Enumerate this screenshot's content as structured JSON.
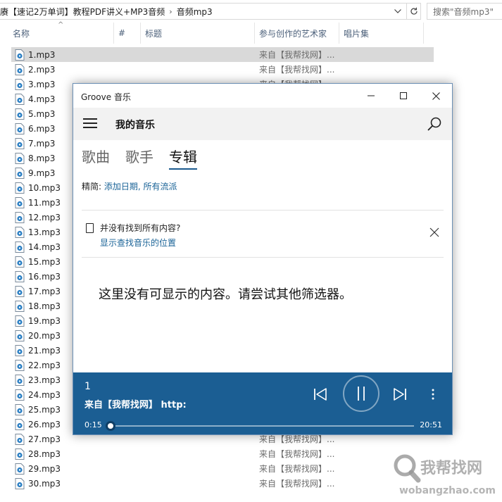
{
  "explorer": {
    "breadcrumb": [
      "赓【速记2万单词】教程PDF讲义+MP3音频",
      "音频mp3"
    ],
    "search_placeholder": "搜索\"音频mp3\"",
    "columns": [
      "名称",
      "#",
      "标题",
      "参与创作的艺术家",
      "唱片集"
    ],
    "files": [
      {
        "name": "1.mp3",
        "artist": "来自【我帮找网】..."
      },
      {
        "name": "2.mp3",
        "artist": "来自【我帮找网】..."
      },
      {
        "name": "3.mp3",
        "artist": "来自【我帮找网】..."
      },
      {
        "name": "4.mp3",
        "artist": ""
      },
      {
        "name": "5.mp3",
        "artist": ""
      },
      {
        "name": "6.mp3",
        "artist": ""
      },
      {
        "name": "7.mp3",
        "artist": ""
      },
      {
        "name": "8.mp3",
        "artist": ""
      },
      {
        "name": "9.mp3",
        "artist": ""
      },
      {
        "name": "10.mp3",
        "artist": ""
      },
      {
        "name": "11.mp3",
        "artist": ""
      },
      {
        "name": "12.mp3",
        "artist": ""
      },
      {
        "name": "13.mp3",
        "artist": ""
      },
      {
        "name": "14.mp3",
        "artist": ""
      },
      {
        "name": "15.mp3",
        "artist": ""
      },
      {
        "name": "16.mp3",
        "artist": ""
      },
      {
        "name": "17.mp3",
        "artist": ""
      },
      {
        "name": "18.mp3",
        "artist": ""
      },
      {
        "name": "19.mp3",
        "artist": ""
      },
      {
        "name": "20.mp3",
        "artist": ""
      },
      {
        "name": "21.mp3",
        "artist": ""
      },
      {
        "name": "22.mp3",
        "artist": ""
      },
      {
        "name": "23.mp3",
        "artist": ""
      },
      {
        "name": "24.mp3",
        "artist": ""
      },
      {
        "name": "25.mp3",
        "artist": ""
      },
      {
        "name": "26.mp3",
        "artist": ""
      },
      {
        "name": "27.mp3",
        "artist": "来自【我帮找网】..."
      },
      {
        "name": "28.mp3",
        "artist": "来自【我帮找网】..."
      },
      {
        "name": "29.mp3",
        "artist": "来自【我帮找网】..."
      },
      {
        "name": "30.mp3",
        "artist": "来自【我帮找网】..."
      }
    ]
  },
  "groove": {
    "window_title": "Groove 音乐",
    "header_title": "我的音乐",
    "tabs": [
      "歌曲",
      "歌手",
      "专辑"
    ],
    "active_tab": "专辑",
    "filter_label": "精简: ",
    "filter_value": "添加日期, 所有流派",
    "notice_title": "并没有找到所有内容?",
    "notice_link": "显示查找音乐的位置",
    "empty_message": "这里没有可显示的内容。请尝试其他筛选器。",
    "player": {
      "title": "1",
      "artist": "来自【我帮找网】 http:",
      "current_time": "0:15",
      "total_time": "20:51",
      "progress": 0.012
    },
    "accent_color": "#1b5e93"
  },
  "watermark": {
    "cn": "我帮找网",
    "en": "wobangzhao.com"
  }
}
